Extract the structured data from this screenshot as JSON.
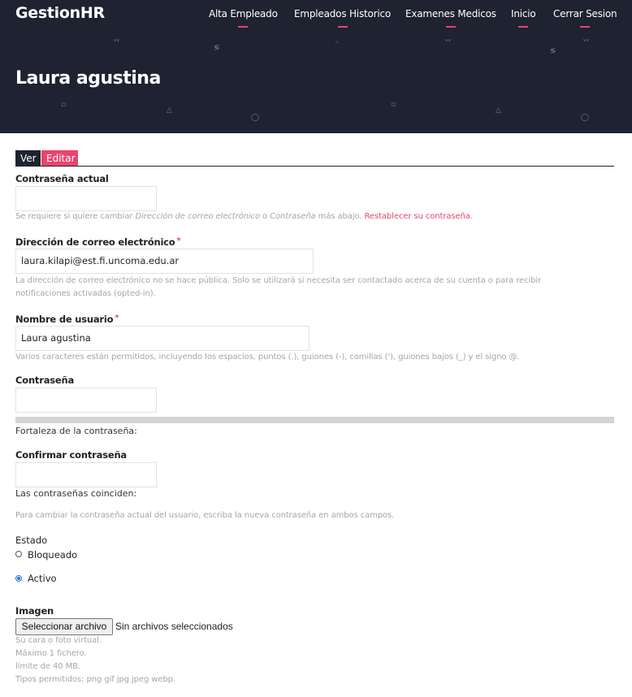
{
  "app": {
    "brand": "GestionHR"
  },
  "nav": {
    "items": [
      {
        "label": "Alta Empleado"
      },
      {
        "label": "Empleados Historico"
      },
      {
        "label": "Examenes Medicos"
      },
      {
        "label": "Inicio"
      },
      {
        "label": "Cerrar Sesion"
      }
    ]
  },
  "page": {
    "title": "Laura agustina"
  },
  "tabs": {
    "ver": "Ver",
    "editar": "Editar"
  },
  "form": {
    "current_password": {
      "label": "Contraseña actual",
      "value": "",
      "help_prefix": "Se requiere si quiere cambiar ",
      "help_em1": "Dirección de correo electrónico",
      "help_mid": " o ",
      "help_em2": "Contraseña",
      "help_suffix": " más abajo. ",
      "help_link": "Restablecer su contraseña",
      "help_end": "."
    },
    "email": {
      "label": "Dirección de correo electrónico",
      "required": "*",
      "value": "laura.kilapi@est.fi.uncoma.edu.ar",
      "help_line1": "La dirección de correo electrónico no se hace pública. Solo se utilizará si necesita ser contactado acerca de su cuenta o para recibir",
      "help_line2": "notificaciones activadas (opted-in)."
    },
    "username": {
      "label": "Nombre de usuario",
      "required": "*",
      "value": "Laura agustina",
      "help": "Varios caracteres están permitidos, incluyendo los espacios, puntos (.), guiones (-), comillas ('), guiones bajos (_) y el signo @."
    },
    "password": {
      "label": "Contraseña",
      "value": "",
      "strength_label": "Fortaleza de la contraseña:",
      "strength": 0
    },
    "confirm_password": {
      "label": "Confirmar contraseña",
      "value": "",
      "match_label": "Las contraseñas coinciden:",
      "help": "Para cambiar la contraseña actual del usuario, escriba la nueva contraseña en ambos campos."
    },
    "status": {
      "label": "Estado",
      "options": [
        {
          "label": "Bloqueado",
          "checked": false
        },
        {
          "label": "Activo",
          "checked": true
        }
      ]
    },
    "image": {
      "label": "Imagen",
      "button": "Seleccionar archivo",
      "file_status": "Sin archivos seleccionados",
      "help_lines": [
        "Su cara o foto virtual.",
        "Máximo 1 fichero.",
        "límite de 40 MB.",
        "Tipos permitidos: png gif jpg jpeg webp."
      ]
    }
  },
  "colors": {
    "header_bg": "#1f2230",
    "accent": "#e8446c",
    "radio_checked": "#1a73e8"
  }
}
